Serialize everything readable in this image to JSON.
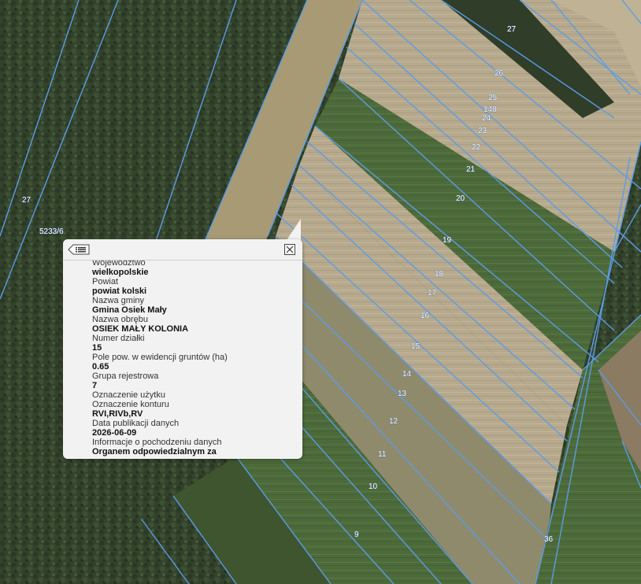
{
  "map": {
    "parcel_labels": [
      {
        "id": "p27a",
        "text": "27"
      },
      {
        "id": "p26",
        "text": "26"
      },
      {
        "id": "p25",
        "text": "25"
      },
      {
        "id": "p148",
        "text": "148"
      },
      {
        "id": "p24",
        "text": "24"
      },
      {
        "id": "p23",
        "text": "23"
      },
      {
        "id": "p22",
        "text": "22"
      },
      {
        "id": "p21",
        "text": "21"
      },
      {
        "id": "p20",
        "text": "20"
      },
      {
        "id": "p19",
        "text": "19"
      },
      {
        "id": "p18",
        "text": "18"
      },
      {
        "id": "p17",
        "text": "17"
      },
      {
        "id": "p16",
        "text": "16"
      },
      {
        "id": "p15",
        "text": "15"
      },
      {
        "id": "p14",
        "text": "14"
      },
      {
        "id": "p13",
        "text": "13"
      },
      {
        "id": "p12",
        "text": "12"
      },
      {
        "id": "p11",
        "text": "11"
      },
      {
        "id": "p10",
        "text": "10"
      },
      {
        "id": "p9",
        "text": "9"
      },
      {
        "id": "p36",
        "text": "36"
      },
      {
        "id": "p27b",
        "text": "27"
      },
      {
        "id": "p5233",
        "text": "5233/6"
      }
    ],
    "colors": {
      "boundary": "#5b9ce8",
      "forest": "#33422c",
      "field_light": "#b9ab8e",
      "field_green": "#4f6b3a"
    }
  },
  "popup": {
    "rows": [
      {
        "label": "Województwo",
        "value": "wielkopolskie"
      },
      {
        "label": "Powiat",
        "value": "powiat kolski"
      },
      {
        "label": "Nazwa gminy",
        "value": "Gmina Osiek Mały"
      },
      {
        "label": "Nazwa obrębu",
        "value": "OSIEK MAŁY KOLONIA"
      },
      {
        "label": "Numer działki",
        "value": "15"
      },
      {
        "label": "Pole pow. w ewidencji gruntów (ha)",
        "value": "0.65"
      },
      {
        "label": "Grupa rejestrowa",
        "value": "7"
      },
      {
        "label": "Oznaczenie użytku",
        "value": ""
      },
      {
        "label": "Oznaczenie konturu",
        "value": "RVI,RIVb,RV"
      },
      {
        "label": "Data publikacji danych",
        "value": "2026-06-09"
      },
      {
        "label": "Informacje o pochodzeniu danych",
        "value": "Organem odpowiedzialnym za"
      }
    ],
    "list_icon": "list-icon",
    "close_icon": "close-icon"
  }
}
